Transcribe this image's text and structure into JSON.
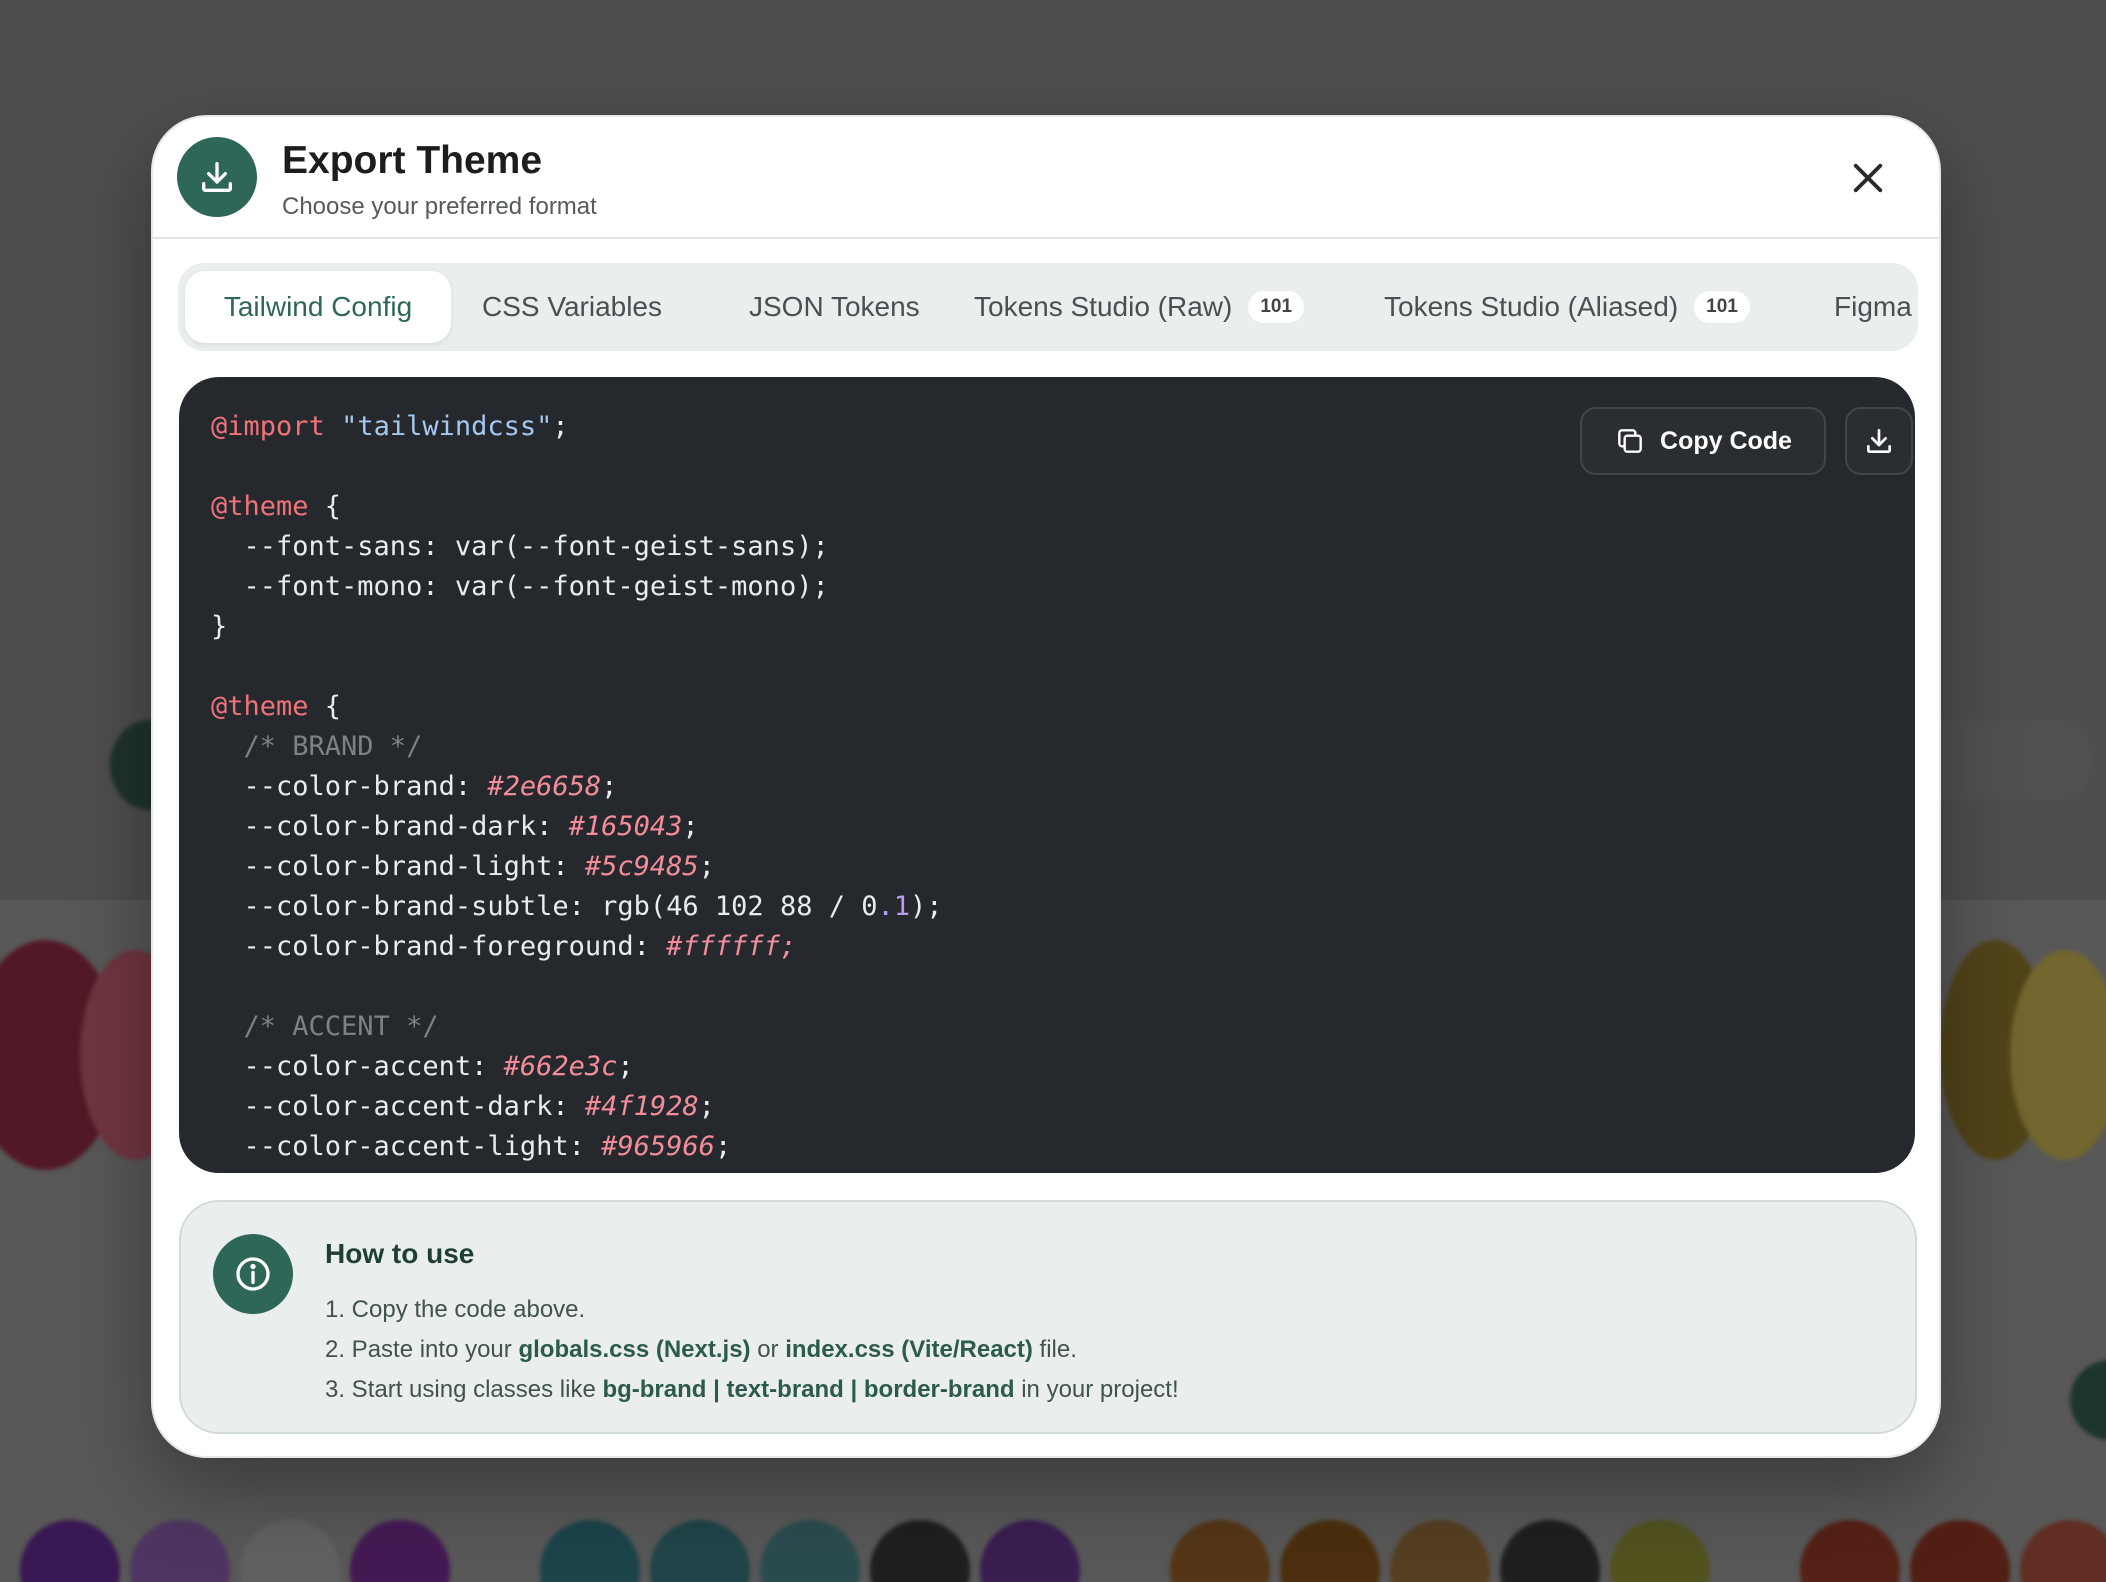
{
  "modal": {
    "title": "Export Theme",
    "subtitle": "Choose your preferred format",
    "header_icon": "download-icon",
    "close_icon": "close-icon"
  },
  "tabs": [
    {
      "label": "Tailwind Config",
      "active": true
    },
    {
      "label": "CSS Variables"
    },
    {
      "label": "JSON Tokens"
    },
    {
      "label": "Tokens Studio (Raw)",
      "badge": "101"
    },
    {
      "label": "Tokens Studio (Aliased)",
      "badge": "101"
    },
    {
      "label": "Figma"
    }
  ],
  "code_actions": {
    "copy_label": "Copy Code",
    "copy_icon": "copy-icon",
    "download_icon": "download-icon"
  },
  "code": {
    "language": "css",
    "lines": [
      "@import \"tailwindcss\";",
      "",
      "@theme {",
      "  --font-sans: var(--font-geist-sans);",
      "  --font-mono: var(--font-geist-mono);",
      "}",
      "",
      "@theme {",
      "  /* BRAND */",
      "  --color-brand: #2e6658;",
      "  --color-brand-dark: #165043;",
      "  --color-brand-light: #5c9485;",
      "  --color-brand-subtle: rgb(46 102 88 / 0.1);",
      "  --color-brand-foreground: #ffffff;",
      "",
      "  /* ACCENT */",
      "  --color-accent: #662e3c;",
      "  --color-accent-dark: #4f1928;",
      "  --color-accent-light: #965966;"
    ]
  },
  "help": {
    "title": "How to use",
    "icon": "info-icon",
    "step1": "1. Copy the code above.",
    "step2_prefix": "2. Paste into your ",
    "step2_file1": "globals.css (Next.js)",
    "step2_mid": " or ",
    "step2_file2": "index.css (Vite/React)",
    "step2_suffix": " file.",
    "step3_prefix": "3. Start using classes like ",
    "step3_classes": "bg-brand | text-brand | border-brand",
    "step3_suffix": " in your project!"
  },
  "colors": {
    "brand": "#2e6658",
    "code_bg": "#25282c",
    "keyword": "#f0737a",
    "string": "#a5c8f0",
    "value": "#f48d9a",
    "comment": "#7d8186",
    "number": "#b79cf0"
  }
}
